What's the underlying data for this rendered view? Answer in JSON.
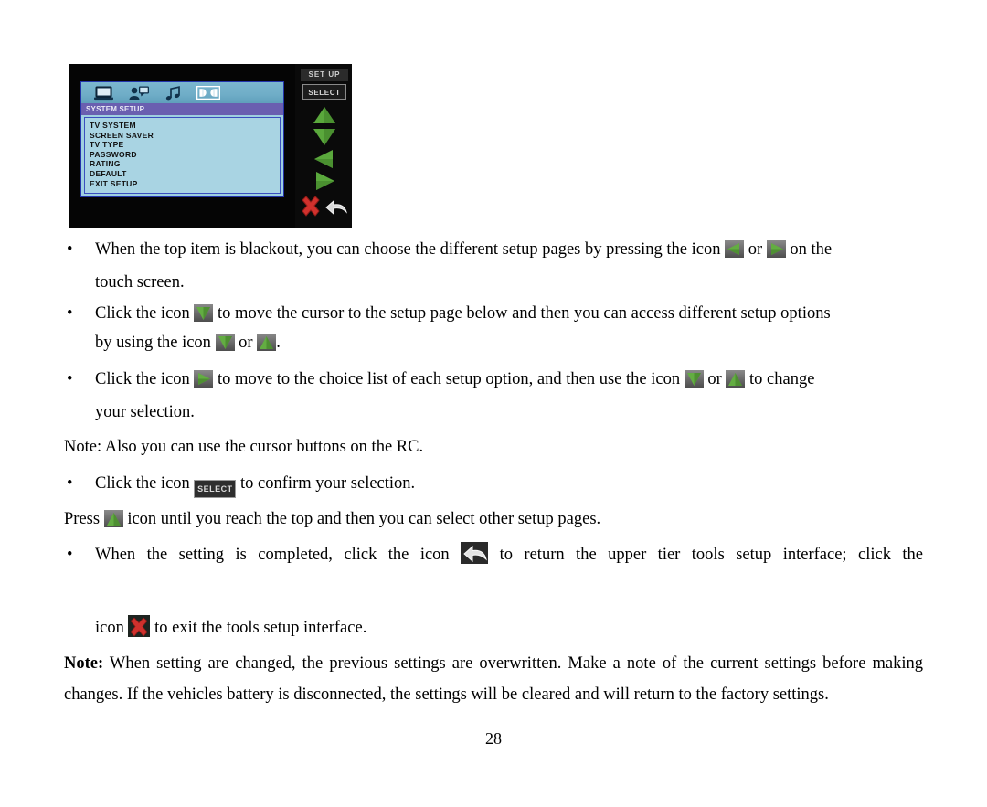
{
  "device": {
    "name": "system-setup-osd",
    "menu_title": "SYSTEM SETUP",
    "icon_bar": [
      {
        "name": "monitor-icon",
        "label": "monitor"
      },
      {
        "name": "person-speaker-icon",
        "label": "video setup"
      },
      {
        "name": "music-note-icon",
        "label": "audio"
      },
      {
        "name": "dolby-icon",
        "label": "dolby digital"
      }
    ],
    "menu_items": [
      "TV SYSTEM",
      "SCREEN SAVER",
      "TV TYPE",
      "PASSWORD",
      "RATING",
      "DEFAULT",
      "EXIT  SETUP"
    ],
    "keys": {
      "setup": "SET UP",
      "select": "SELECT",
      "up": "up-arrow",
      "down": "down-arrow",
      "left": "left-arrow",
      "right": "right-arrow",
      "exit": "exit-x",
      "return": "return-arrow"
    }
  },
  "colors": {
    "osd_blue": "#a9d4e3",
    "osd_title_purple": "#6a5fb0",
    "osd_iconbar": "#6fadc7",
    "arrow_green": "#5aa83c",
    "exit_red": "#cc2222",
    "device_black": "#0a0a0a"
  },
  "doc": {
    "bullet": "•",
    "b1": {
      "part1": "When the top item is blackout, you can choose the different setup pages by pressing the icon",
      "mid": "or",
      "part2": "on the",
      "line2": "touch screen."
    },
    "b2": {
      "part1": "Click the icon",
      "part2": "to move the cursor to the setup page below and then you can access different setup options",
      "line2a": "by using the icon",
      "line2mid": "or",
      "line2b": "."
    },
    "b3": {
      "part1": "Click the icon",
      "part2": "to move to the choice list of each setup option, and then use the icon",
      "mid": "or",
      "part3": "to change",
      "line2": "your selection."
    },
    "note_rc": "Note: Also you can use the cursor buttons on the RC.",
    "b4": {
      "part1": "Click the icon",
      "select_label": "SELECT",
      "part2": "to confirm your selection."
    },
    "press_line": {
      "part1": "Press",
      "part2": "icon until you reach the top and then you can select other setup pages."
    },
    "b5": {
      "part1": "When the setting is completed, click the icon",
      "part2": "to return the upper tier tools setup interface; click the",
      "line2a": "icon",
      "line2b": "to exit the tools setup interface."
    },
    "final_note": {
      "label": "Note:",
      "text": " When setting are changed, the previous settings are overwritten. Make a note of the current settings before making changes. If the vehicles battery is disconnected, the settings will be cleared and will return to the factory settings."
    },
    "page_number": "28"
  }
}
